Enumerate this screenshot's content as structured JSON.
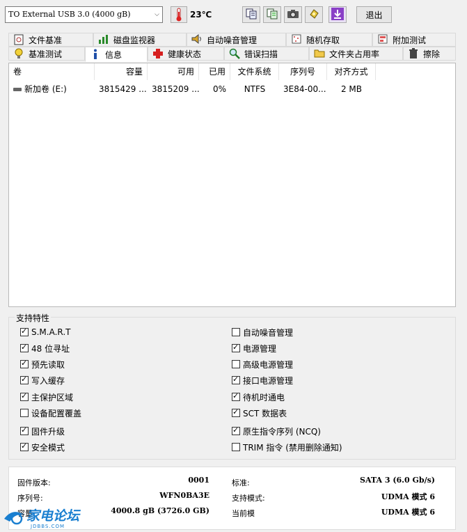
{
  "toolbar": {
    "drive_name": "TO External USB 3.0 (4000 gB)",
    "temperature": "23℃",
    "exit_label": "退出",
    "icons": [
      "thermometer-icon",
      "copy-icon",
      "copy-green-icon",
      "camera-icon",
      "hand-icon",
      "download-icon"
    ]
  },
  "tabs": {
    "row1": [
      "文件基准",
      "磁盘监视器",
      "自动噪音管理",
      "随机存取",
      "附加测试"
    ],
    "row2": [
      "基准测试",
      "信息",
      "健康状态",
      "错误扫描",
      "文件夹占用率",
      "擦除"
    ],
    "active": "信息"
  },
  "volumes": {
    "headers": [
      "卷",
      "容量",
      "可用",
      "已用",
      "文件系统",
      "序列号",
      "对齐方式"
    ],
    "rows": [
      {
        "name": "新加卷 (E:)",
        "capacity": "3815429 ...",
        "free": "3815209 ...",
        "used": "0%",
        "fs": "NTFS",
        "serial": "3E84-00...",
        "align": "2 MB"
      }
    ]
  },
  "features": {
    "title": "支持特性",
    "left": [
      {
        "label": "S.M.A.R.T",
        "checked": true
      },
      {
        "label": "48 位寻址",
        "checked": true
      },
      {
        "label": "预先读取",
        "checked": true
      },
      {
        "label": "写入缓存",
        "checked": true
      },
      {
        "label": "主保护区域",
        "checked": true
      },
      {
        "label": "设备配置覆盖",
        "checked": false
      },
      {
        "label": "固件升级",
        "checked": true
      },
      {
        "label": "安全模式",
        "checked": true
      }
    ],
    "right": [
      {
        "label": "自动噪音管理",
        "checked": false
      },
      {
        "label": "电源管理",
        "checked": true
      },
      {
        "label": "高级电源管理",
        "checked": false
      },
      {
        "label": "接口电源管理",
        "checked": true
      },
      {
        "label": "待机时通电",
        "checked": true
      },
      {
        "label": "SCT 数据表",
        "checked": true
      },
      {
        "label": "原生指令序列 (NCQ)",
        "checked": true
      },
      {
        "label": "TRIM 指令 (禁用删除通知)",
        "checked": false
      }
    ]
  },
  "info": {
    "firmware_label": "固件版本:",
    "firmware": "0001",
    "serial_label": "序列号:",
    "serial": "WFN0BA3E",
    "capacity_label": "容量",
    "capacity": "4000.8 gB (3726.0 GB)",
    "standard_label": "标准:",
    "standard": "SATA 3 (6.0 Gb/s)",
    "supported_label": "支持模式:",
    "supported": "UDMA 模式 6",
    "current_label": "当前模",
    "current": "UDMA 模式 6"
  },
  "watermark": {
    "name": "家电论坛",
    "domain": "JDBBS.COM"
  }
}
